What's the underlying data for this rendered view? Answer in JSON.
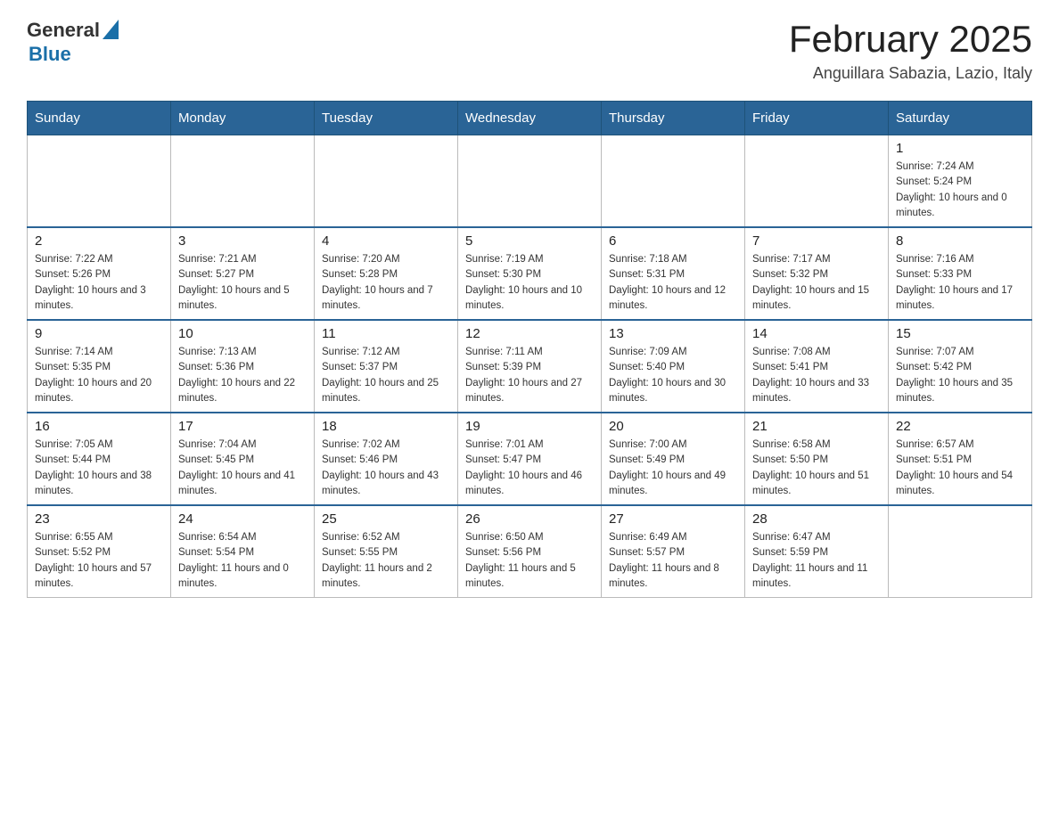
{
  "header": {
    "logo": {
      "general": "General",
      "blue": "Blue"
    },
    "title": "February 2025",
    "location": "Anguillara Sabazia, Lazio, Italy"
  },
  "days_of_week": [
    "Sunday",
    "Monday",
    "Tuesday",
    "Wednesday",
    "Thursday",
    "Friday",
    "Saturday"
  ],
  "weeks": [
    [
      {
        "day": "",
        "info": ""
      },
      {
        "day": "",
        "info": ""
      },
      {
        "day": "",
        "info": ""
      },
      {
        "day": "",
        "info": ""
      },
      {
        "day": "",
        "info": ""
      },
      {
        "day": "",
        "info": ""
      },
      {
        "day": "1",
        "info": "Sunrise: 7:24 AM\nSunset: 5:24 PM\nDaylight: 10 hours and 0 minutes."
      }
    ],
    [
      {
        "day": "2",
        "info": "Sunrise: 7:22 AM\nSunset: 5:26 PM\nDaylight: 10 hours and 3 minutes."
      },
      {
        "day": "3",
        "info": "Sunrise: 7:21 AM\nSunset: 5:27 PM\nDaylight: 10 hours and 5 minutes."
      },
      {
        "day": "4",
        "info": "Sunrise: 7:20 AM\nSunset: 5:28 PM\nDaylight: 10 hours and 7 minutes."
      },
      {
        "day": "5",
        "info": "Sunrise: 7:19 AM\nSunset: 5:30 PM\nDaylight: 10 hours and 10 minutes."
      },
      {
        "day": "6",
        "info": "Sunrise: 7:18 AM\nSunset: 5:31 PM\nDaylight: 10 hours and 12 minutes."
      },
      {
        "day": "7",
        "info": "Sunrise: 7:17 AM\nSunset: 5:32 PM\nDaylight: 10 hours and 15 minutes."
      },
      {
        "day": "8",
        "info": "Sunrise: 7:16 AM\nSunset: 5:33 PM\nDaylight: 10 hours and 17 minutes."
      }
    ],
    [
      {
        "day": "9",
        "info": "Sunrise: 7:14 AM\nSunset: 5:35 PM\nDaylight: 10 hours and 20 minutes."
      },
      {
        "day": "10",
        "info": "Sunrise: 7:13 AM\nSunset: 5:36 PM\nDaylight: 10 hours and 22 minutes."
      },
      {
        "day": "11",
        "info": "Sunrise: 7:12 AM\nSunset: 5:37 PM\nDaylight: 10 hours and 25 minutes."
      },
      {
        "day": "12",
        "info": "Sunrise: 7:11 AM\nSunset: 5:39 PM\nDaylight: 10 hours and 27 minutes."
      },
      {
        "day": "13",
        "info": "Sunrise: 7:09 AM\nSunset: 5:40 PM\nDaylight: 10 hours and 30 minutes."
      },
      {
        "day": "14",
        "info": "Sunrise: 7:08 AM\nSunset: 5:41 PM\nDaylight: 10 hours and 33 minutes."
      },
      {
        "day": "15",
        "info": "Sunrise: 7:07 AM\nSunset: 5:42 PM\nDaylight: 10 hours and 35 minutes."
      }
    ],
    [
      {
        "day": "16",
        "info": "Sunrise: 7:05 AM\nSunset: 5:44 PM\nDaylight: 10 hours and 38 minutes."
      },
      {
        "day": "17",
        "info": "Sunrise: 7:04 AM\nSunset: 5:45 PM\nDaylight: 10 hours and 41 minutes."
      },
      {
        "day": "18",
        "info": "Sunrise: 7:02 AM\nSunset: 5:46 PM\nDaylight: 10 hours and 43 minutes."
      },
      {
        "day": "19",
        "info": "Sunrise: 7:01 AM\nSunset: 5:47 PM\nDaylight: 10 hours and 46 minutes."
      },
      {
        "day": "20",
        "info": "Sunrise: 7:00 AM\nSunset: 5:49 PM\nDaylight: 10 hours and 49 minutes."
      },
      {
        "day": "21",
        "info": "Sunrise: 6:58 AM\nSunset: 5:50 PM\nDaylight: 10 hours and 51 minutes."
      },
      {
        "day": "22",
        "info": "Sunrise: 6:57 AM\nSunset: 5:51 PM\nDaylight: 10 hours and 54 minutes."
      }
    ],
    [
      {
        "day": "23",
        "info": "Sunrise: 6:55 AM\nSunset: 5:52 PM\nDaylight: 10 hours and 57 minutes."
      },
      {
        "day": "24",
        "info": "Sunrise: 6:54 AM\nSunset: 5:54 PM\nDaylight: 11 hours and 0 minutes."
      },
      {
        "day": "25",
        "info": "Sunrise: 6:52 AM\nSunset: 5:55 PM\nDaylight: 11 hours and 2 minutes."
      },
      {
        "day": "26",
        "info": "Sunrise: 6:50 AM\nSunset: 5:56 PM\nDaylight: 11 hours and 5 minutes."
      },
      {
        "day": "27",
        "info": "Sunrise: 6:49 AM\nSunset: 5:57 PM\nDaylight: 11 hours and 8 minutes."
      },
      {
        "day": "28",
        "info": "Sunrise: 6:47 AM\nSunset: 5:59 PM\nDaylight: 11 hours and 11 minutes."
      },
      {
        "day": "",
        "info": ""
      }
    ]
  ]
}
